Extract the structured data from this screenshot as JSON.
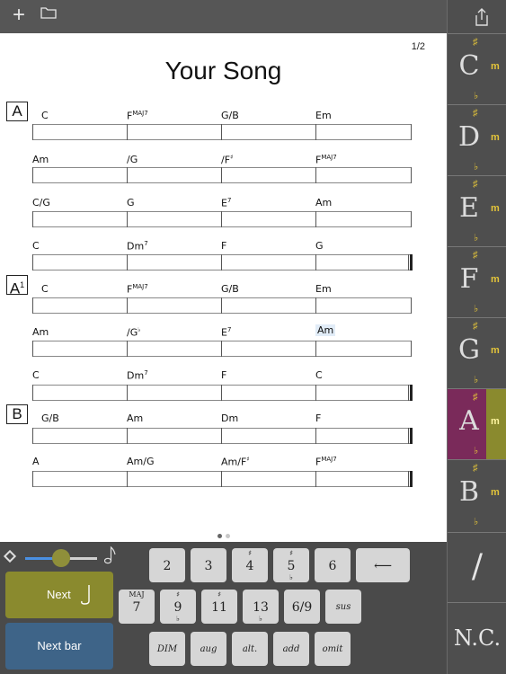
{
  "toolbar": {
    "add_icon": "plus-icon",
    "folder_icon": "folder-icon",
    "share_icon": "share-icon"
  },
  "sheet": {
    "page": "1/2",
    "title": "Your Song",
    "sections": [
      "A",
      "A",
      "B"
    ],
    "section_a1_sup": "1",
    "rows": [
      [
        "C",
        "F",
        "G/B",
        "Em"
      ],
      [
        "Am",
        "/G",
        "/F",
        "F"
      ],
      [
        "C/G",
        "G",
        "E",
        "Am"
      ],
      [
        "C",
        "Dm",
        "F",
        "G"
      ],
      [
        "C",
        "F",
        "G/B",
        "Em"
      ],
      [
        "Am",
        "/G",
        "E",
        "Am"
      ],
      [
        "C",
        "Dm",
        "F",
        "C"
      ],
      [
        "G/B",
        "Am",
        "Dm",
        "F"
      ],
      [
        "A",
        "Am/G",
        "Am/F",
        "F"
      ]
    ],
    "sups": {
      "maj7": "MAJ7",
      "seven": "7",
      "sharp": "♯",
      "flat": "♭"
    }
  },
  "keys": [
    {
      "label": "C",
      "sharp": "♯",
      "flat": "♭",
      "minor": "m"
    },
    {
      "label": "D",
      "sharp": "♯",
      "flat": "♭",
      "minor": "m"
    },
    {
      "label": "E",
      "sharp": "♯",
      "flat": "♭",
      "minor": "m"
    },
    {
      "label": "F",
      "sharp": "♯",
      "flat": "♭",
      "minor": "m"
    },
    {
      "label": "G",
      "sharp": "♯",
      "flat": "♭",
      "minor": "m"
    },
    {
      "label": "A",
      "sharp": "♯",
      "flat": "♭",
      "minor": "m"
    },
    {
      "label": "B",
      "sharp": "♯",
      "flat": "♭",
      "minor": "m"
    }
  ],
  "active_key": "A",
  "slash_label": "/",
  "nc_label": "N.C.",
  "controls": {
    "next": "Next",
    "next_bar": "Next bar",
    "slider_value": 0.5
  },
  "quality_keys": {
    "r1": [
      "2",
      "3",
      "4",
      "5",
      "6",
      "⟵"
    ],
    "r1_top": [
      "",
      "",
      "♯",
      "♯",
      "",
      ""
    ],
    "r1_bot": [
      "",
      "",
      "",
      "♭",
      "",
      ""
    ],
    "r2": [
      "7",
      "9",
      "11",
      "13",
      "6/9",
      "sus"
    ],
    "r2_top": [
      "MAJ",
      "♯",
      "♯",
      "",
      "",
      ""
    ],
    "r2_bot": [
      "",
      "♭",
      "",
      "♭",
      "",
      ""
    ],
    "r3": [
      "DIM",
      "aug",
      "alt.",
      "add",
      "omit"
    ]
  },
  "colors": {
    "active_key": "#7a2a5a",
    "minor_active": "#8a8a2e",
    "next": "#8a8a2e",
    "next_bar": "#3e6488",
    "accidental": "#e3c43a"
  }
}
